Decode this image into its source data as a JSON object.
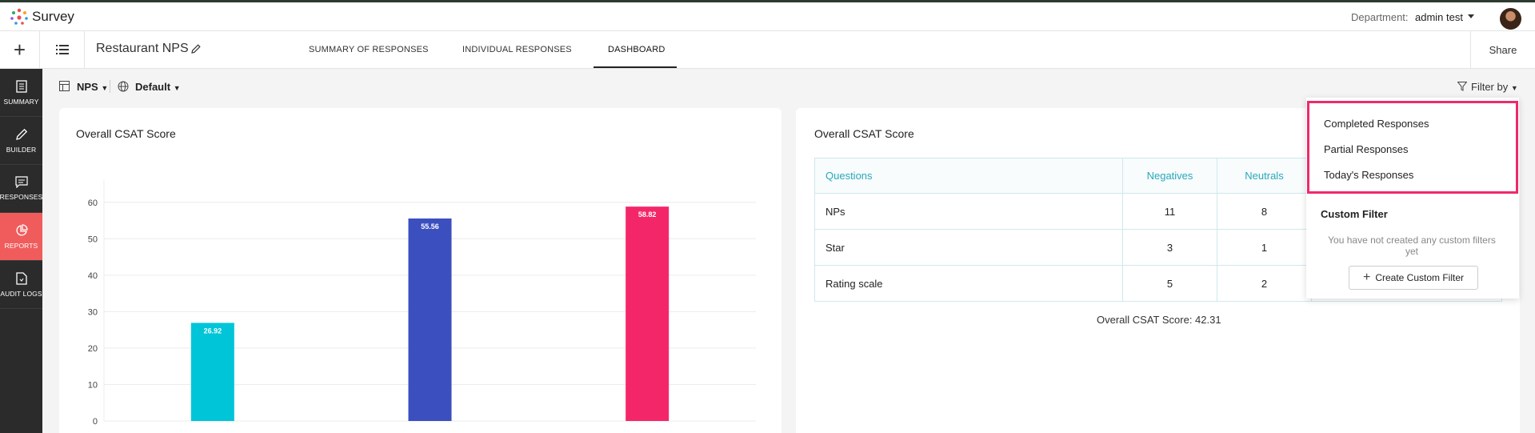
{
  "app": {
    "brand": "Survey"
  },
  "header": {
    "department_label": "Department:",
    "department_value": "admin test"
  },
  "subbar": {
    "survey_title": "Restaurant NPS",
    "tabs": [
      {
        "label": "SUMMARY OF RESPONSES"
      },
      {
        "label": "INDIVIDUAL RESPONSES"
      },
      {
        "label": "DASHBOARD"
      }
    ],
    "active_tab": "DASHBOARD",
    "share_label": "Share"
  },
  "sidebar": {
    "items": [
      {
        "label": "SUMMARY",
        "icon": "document-icon"
      },
      {
        "label": "BUILDER",
        "icon": "pencil-icon"
      },
      {
        "label": "RESPONSES",
        "icon": "chat-icon"
      },
      {
        "label": "REPORTS",
        "icon": "pie-chart-icon",
        "active": true
      },
      {
        "label": "AUDIT LOGS",
        "icon": "log-file-icon"
      }
    ]
  },
  "toolbar": {
    "view_label": "NPS",
    "lang_label": "Default",
    "filter_label": "Filter by"
  },
  "left_card": {
    "title": "Overall CSAT Score"
  },
  "chart_data": {
    "type": "bar",
    "categories": [
      "",
      "",
      ""
    ],
    "values": [
      26.92,
      55.56,
      58.82
    ],
    "value_labels": [
      "26.92",
      "55.56",
      "58.82"
    ],
    "colors": [
      "#00c5d8",
      "#3b4fbf",
      "#f4266a"
    ],
    "yticks": [
      "0",
      "10",
      "20",
      "30",
      "40",
      "50",
      "60"
    ],
    "ylim": [
      0,
      65
    ],
    "grid": true
  },
  "right_card": {
    "title": "Overall CSAT Score",
    "columns": [
      "Questions",
      "Negatives",
      "Neutrals"
    ],
    "rows": [
      [
        "NPs",
        "11",
        "8"
      ],
      [
        "Star",
        "3",
        "1"
      ],
      [
        "Rating scale",
        "5",
        "2"
      ]
    ],
    "overall_label": "Overall CSAT Score: 42.31"
  },
  "filter_dropdown": {
    "items": [
      "Completed Responses",
      "Partial Responses",
      "Today's Responses"
    ],
    "custom_heading": "Custom Filter",
    "empty_text": "You have not created any custom filters yet",
    "create_label": "Create Custom Filter"
  },
  "colors": {
    "accent_reports": "#f05c5c",
    "table_header": "#28a8ba",
    "highlight": "#ee2a6a"
  }
}
